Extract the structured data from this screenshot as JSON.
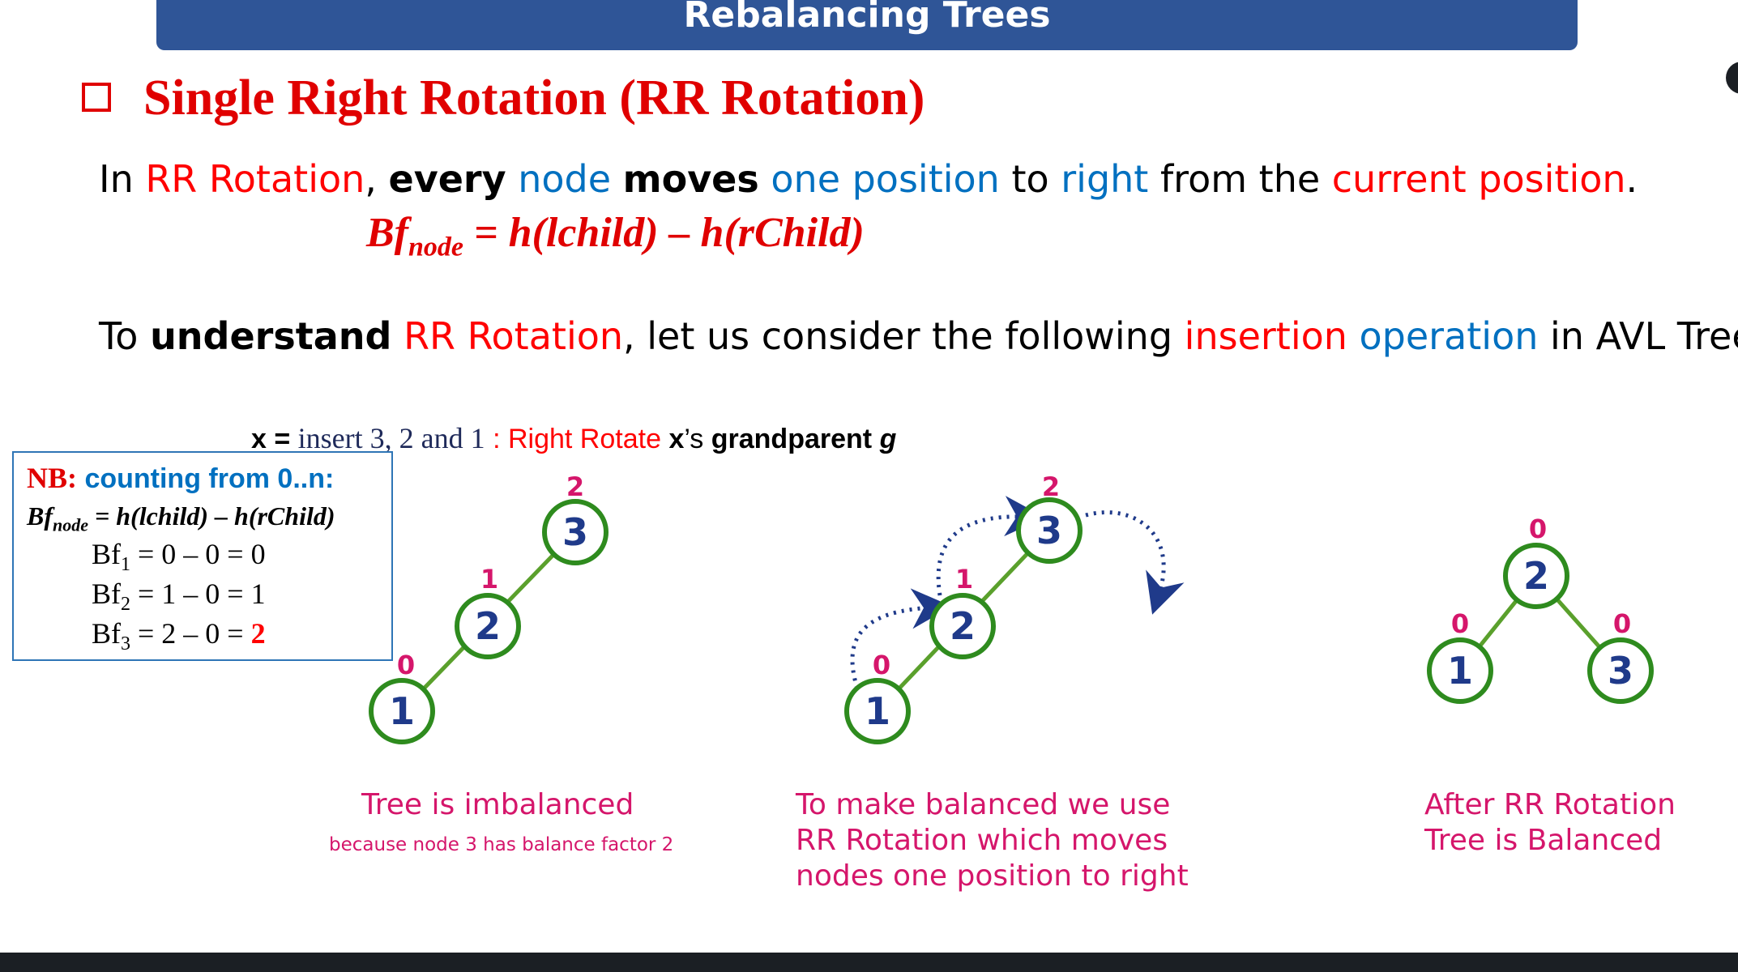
{
  "header": {
    "title": "Rebalancing Trees"
  },
  "slide": {
    "title": "Single Right Rotation (RR Rotation)",
    "line1": {
      "p1": "In ",
      "p2": "RR Rotation",
      "p3": ", ",
      "p4": "every",
      "p5": " ",
      "p6": "node",
      "p7": " ",
      "p8": "moves",
      "p9": " ",
      "p10": "one position",
      "p11": " to ",
      "p12": "right",
      "p13": " from the ",
      "p14": "current position",
      "p15": "."
    },
    "formula": {
      "bf": "Bf",
      "sub": "node",
      "rest": " = h(lchild) – h(rChild)"
    },
    "line2": {
      "p1": "To ",
      "p2": "understand",
      "p3": " ",
      "p4": "RR Rotation",
      "p5": ", let us consider the following ",
      "p6": "insertion",
      "p7": " ",
      "p8": "operation",
      "p9": " in AVL Tree.."
    },
    "xline": {
      "x_label": "x = ",
      "insert": "insert 3, 2 and 1",
      "colon": " : ",
      "rotate": "Right Rotate",
      "x": "x",
      "apos": "’s ",
      "gp": "grandparent",
      "g": "g"
    }
  },
  "nb_box": {
    "nb": "NB:",
    "counting": " counting from 0..n:",
    "formula_bf": "Bf",
    "formula_sub": "node",
    "formula_rest": " = h(lchild) – h(rChild)",
    "rows": [
      {
        "bf": "Bf",
        "sub": "1",
        "expr": " = 0 – 0 = ",
        "result": "0"
      },
      {
        "bf": "Bf",
        "sub": "2",
        "expr": " = 1 – 0 = ",
        "result": "1"
      },
      {
        "bf": "Bf",
        "sub": "3",
        "expr": " = 2 – 0 = ",
        "result": "2"
      }
    ]
  },
  "diagrams": {
    "tree1": {
      "nodes": [
        {
          "label": "3",
          "bf": "2"
        },
        {
          "label": "2",
          "bf": "1"
        },
        {
          "label": "1",
          "bf": "0"
        }
      ],
      "caption": "Tree is imbalanced",
      "subcaption": "because node 3 has balance factor 2"
    },
    "tree2": {
      "nodes": [
        {
          "label": "3",
          "bf": "2"
        },
        {
          "label": "2",
          "bf": "1"
        },
        {
          "label": "1",
          "bf": "0"
        }
      ],
      "caption_lines": [
        "To make balanced we use",
        "RR Rotation which moves",
        "nodes one position to right"
      ]
    },
    "tree3": {
      "nodes": [
        {
          "label": "2",
          "bf": "0"
        },
        {
          "label": "1",
          "bf": "0"
        },
        {
          "label": "3",
          "bf": "0"
        }
      ],
      "caption_lines": [
        "After RR Rotation",
        "Tree is Balanced"
      ]
    }
  },
  "colors": {
    "header": "#2f5597",
    "title_red": "#e00000",
    "blue": "#0070c0",
    "node_green": "#3a9a1a",
    "node_text": "#1f3a8a",
    "caption_pink": "#d5166b"
  }
}
